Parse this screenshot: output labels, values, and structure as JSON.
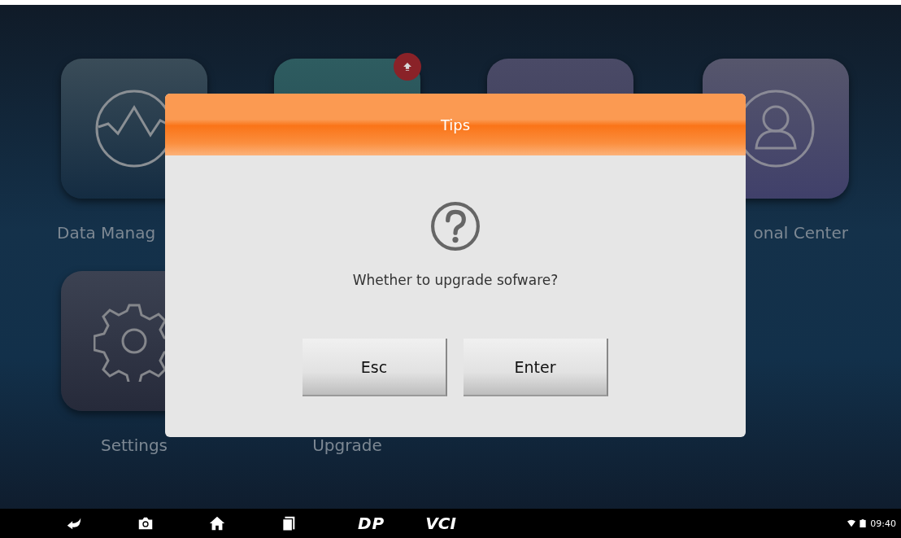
{
  "apps": [
    {
      "label": "Data Manag",
      "badge": false
    },
    {
      "badge": true
    },
    {
      "badge": false
    },
    {
      "label": "onal Center",
      "badge": false
    },
    {
      "label": "Settings",
      "badge": false
    },
    {
      "label": "Upgrade",
      "badge": false
    }
  ],
  "dialog": {
    "title": "Tips",
    "message": "Whether to upgrade sofware?",
    "buttons": [
      "Esc",
      "Enter"
    ]
  },
  "nav_bar": {
    "brand": "DP",
    "vci": "VCI",
    "time": "09:40"
  }
}
